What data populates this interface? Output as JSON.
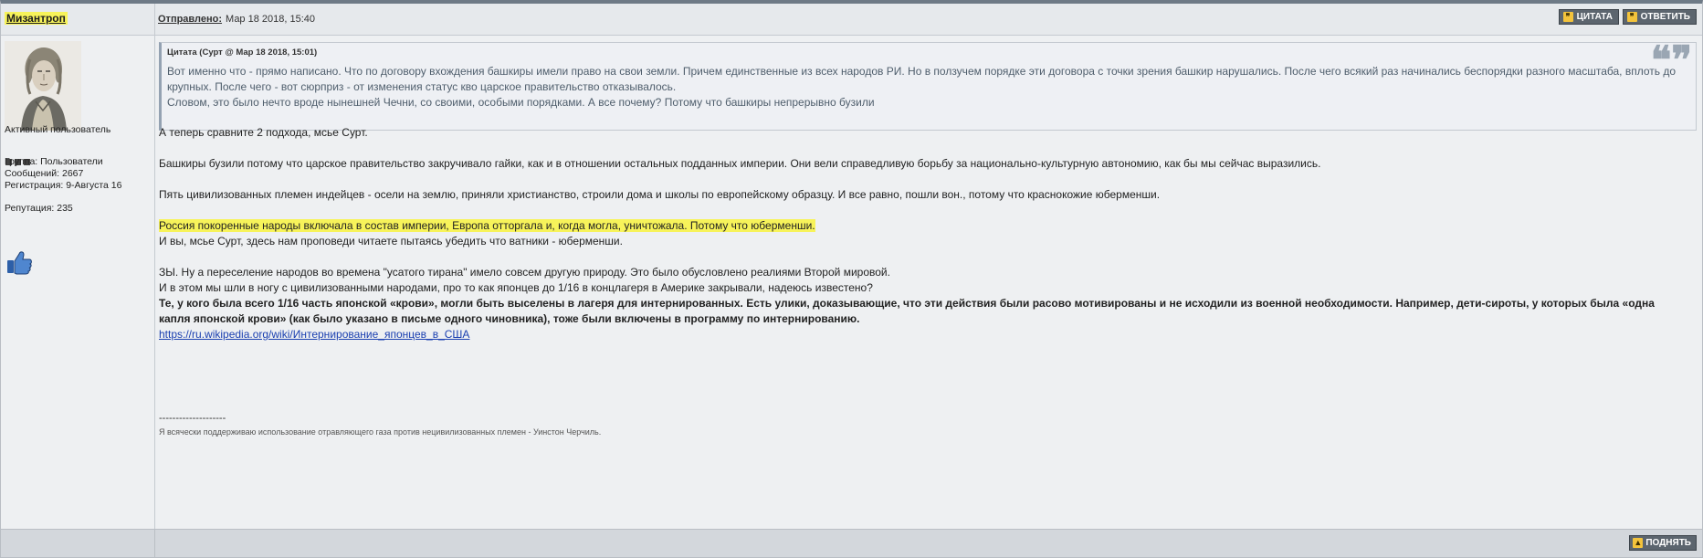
{
  "post": {
    "author": "Мизантроп",
    "posted_label": "Отправлено:",
    "posted_date": "Мар 18 2018, 15:40",
    "quote_button": "ЦИТАТА",
    "reply_button": "ОТВЕТИТЬ",
    "up_button": "ПОДНЯТЬ"
  },
  "user": {
    "title": "Активный пользователь",
    "group": "Группа: Пользователи",
    "posts": "Сообщений: 2667",
    "registered": "Регистрация: 9-Августа 16",
    "reputation": "Репутация: 235"
  },
  "quote": {
    "header": "Цитата (Сурт @ Мар 18 2018, 15:01)",
    "line1": "Вот именно что - прямо написано. Что по договору вхождения башкиры имели право на свои земли. Причем единственные из всех народов РИ. Но в ползучем порядке эти договора с точки зрения башкир нарушались. После чего всякий раз начинались беспорядки разного масштаба, вплоть до крупных. После чего - вот сюрприз - от изменения статус кво царское правительство отказывалось.",
    "line2": "Словом, это было нечто вроде нынешней Чечни, со своими, особыми порядками. А все почему? Потому что башкиры непрерывно бузили"
  },
  "body": {
    "p1": "А теперь сравните 2 подхода, мсье Сурт.",
    "p2": "Башкиры бузили потому что царское правительство закручивало гайки, как и в отношении остальных подданных империи. Они вели справедливую борьбу за национально-культурную автономию, как бы мы сейчас выразились.",
    "p3": "Пять цивилизованных племен индейцев - осели на землю, приняли христианство, строили дома и школы по европейскому образцу. И все равно, пошли вон., потому что краснокожие юберменши.",
    "p4_highlight": "Россия покоренные народы включала в состав империи, Европа отторгала и, когда могла, уничтожала. Потому что юберменши.",
    "p5": "И вы, мсье Сурт, здесь нам проповеди читаете пытаясь убедить что ватники - юберменши.",
    "p6": "ЗЫ. Ну а переселение народов во времена \"усатого тирана\" имело совсем другую природу. Это было обусловлено реалиями Второй мировой.",
    "p7": "И в этом мы шли в ногу с цивилизованными народами, про то как японцев до 1/16 в концлагеря в Америке закрывали, надеюсь известено?",
    "p8_bold": "Те, у кого была всего 1/16 часть японской «крови», могли быть выселены в лагеря для интернированных. Есть улики, доказывающие, что эти действия были расово мотивированы и не исходили из военной необходимости. Например, дети-сироты, у которых была «одна капля японской крови» (как было указано в письме одного чиновника), тоже были включены в программу по интернированию.",
    "link": "https://ru.wikipedia.org/wiki/Интернирование_японцев_в_США"
  },
  "signature": {
    "separator": "--------------------",
    "text": "Я всячески поддерживаю использование отравляющего газа против нецивилизованных племен - Уинстон Черчиль."
  },
  "colors": {
    "highlight": "#f7f35a",
    "button_bg": "#5c656e",
    "button_icon": "#f3c33b",
    "link": "#1a3fb0"
  },
  "icons": [
    "quote-icon",
    "reply-icon",
    "up-arrow-icon",
    "thumbs-up-icon",
    "avatar-portrait"
  ]
}
